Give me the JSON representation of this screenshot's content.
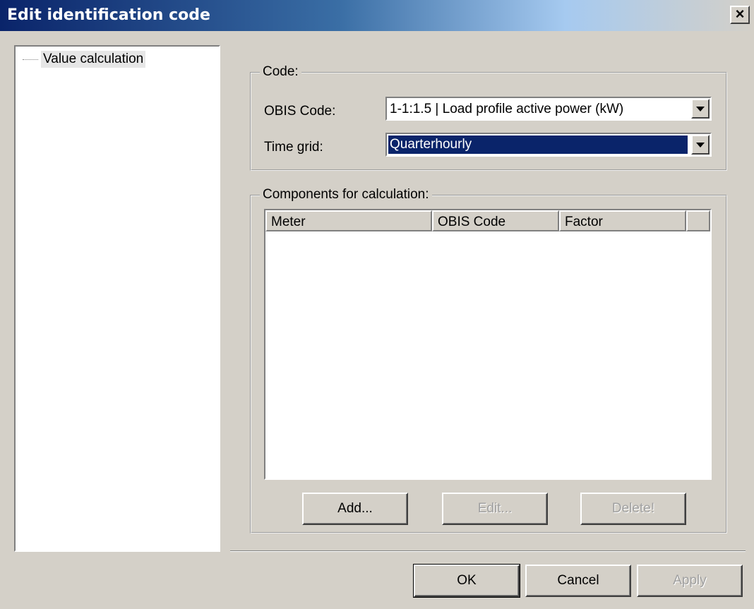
{
  "window": {
    "title": "Edit identification code",
    "close_label": "×"
  },
  "tree": {
    "items": [
      {
        "label": "Value calculation"
      }
    ]
  },
  "code_group": {
    "legend": "Code:",
    "obis_label": "OBIS Code:",
    "obis_value": "1-1:1.5 | Load profile active power (kW)",
    "time_grid_label": "Time grid:",
    "time_grid_value": "Quarterhourly"
  },
  "components_group": {
    "legend": "Components for calculation:",
    "columns": [
      "Meter",
      "OBIS Code",
      "Factor"
    ],
    "rows": [],
    "add_label": "Add...",
    "edit_label": "Edit...",
    "delete_label": "Delete!"
  },
  "footer": {
    "ok_label": "OK",
    "cancel_label": "Cancel",
    "apply_label": "Apply"
  }
}
